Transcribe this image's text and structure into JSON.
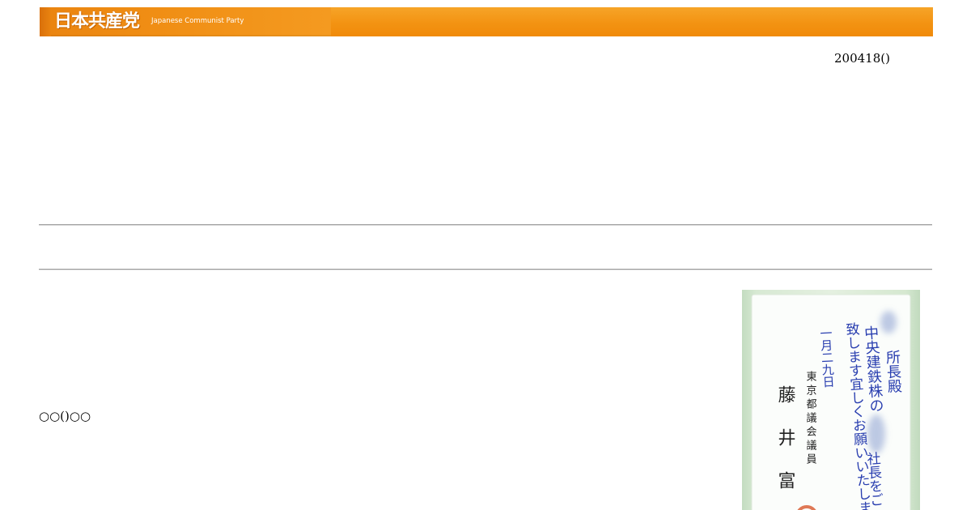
{
  "header": {
    "logo_text": "日本共産党",
    "logo_subtitle": "Japanese Communist Party",
    "color": "#f39312"
  },
  "date_text": "200418()",
  "body_text": "○○()○○",
  "card_image": {
    "recipient": "所長殿",
    "line_company": "中央建鉄株の",
    "line_president": "社長をご",
    "line_request": "致します宜しくお願いいたします",
    "date": "一月二九日",
    "affiliation": "東京都議会議員",
    "signature": "藤 井 富",
    "background": "#e4f0e0",
    "ink_color": "#2a3fb0"
  }
}
